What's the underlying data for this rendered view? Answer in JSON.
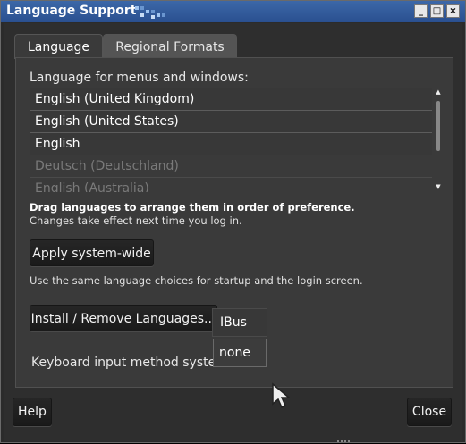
{
  "window": {
    "title": "Language Support",
    "controls": {
      "minimize": "_",
      "maximize": "□",
      "close": "×"
    }
  },
  "tabs": [
    {
      "label": "Language",
      "selected": true
    },
    {
      "label": "Regional Formats",
      "selected": false
    }
  ],
  "language_panel": {
    "list_label": "Language for menus and windows:",
    "languages": [
      {
        "label": "English (United Kingdom)",
        "enabled": true
      },
      {
        "label": "English (United States)",
        "enabled": true
      },
      {
        "label": "English",
        "enabled": true
      },
      {
        "label": "Deutsch (Deutschland)",
        "enabled": false
      },
      {
        "label": "English (Australia)",
        "enabled": false
      }
    ],
    "hint_bold": "Drag languages to arrange them in order of preference.",
    "hint": "Changes take effect next time you log in.",
    "apply_button": "Apply system-wide",
    "apply_note": "Use the same language choices for startup and the login screen.",
    "install_button": "Install / Remove Languages...",
    "input_method_label": "Keyboard input method system:",
    "input_method_value": "IBus",
    "input_method_option": "none"
  },
  "footer": {
    "help_button": "Help",
    "close_button": "Close"
  },
  "colors": {
    "titlebar": "#2a5090",
    "background": "#2e2e2e",
    "panel": "#3a3a3a",
    "text": "#e8e8e8",
    "disabled_text": "#7a7a7a"
  }
}
